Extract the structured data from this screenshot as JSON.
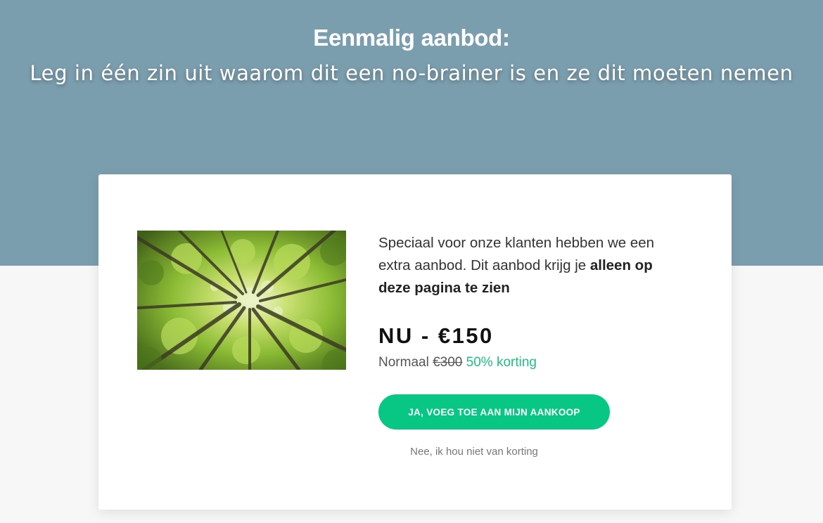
{
  "colors": {
    "hero_background": "#7b9eae",
    "page_background": "#f7f7f7",
    "card_background": "#ffffff",
    "accent_green": "#08c784",
    "discount_text": "#1fbf86"
  },
  "hero": {
    "title": "Eenmalig aanbod:",
    "subtitle": "Leg in één zin uit waarom dit een no-brainer is en ze dit moeten nemen"
  },
  "offer": {
    "image_icon": "forest-canopy-photo",
    "description_start": "Speciaal voor onze klanten hebben we een extra aanbod. Dit aanbod krijg je ",
    "description_bold": "alleen op deze pagina te zien",
    "price_label": "NU - €150",
    "normal_label": "Normaal",
    "old_price": "€300",
    "discount_label": "50% korting",
    "cta_label": "JA, VOEG TOE AAN MIJN AANKOOP",
    "decline_label": "Nee, ik hou niet van korting"
  }
}
